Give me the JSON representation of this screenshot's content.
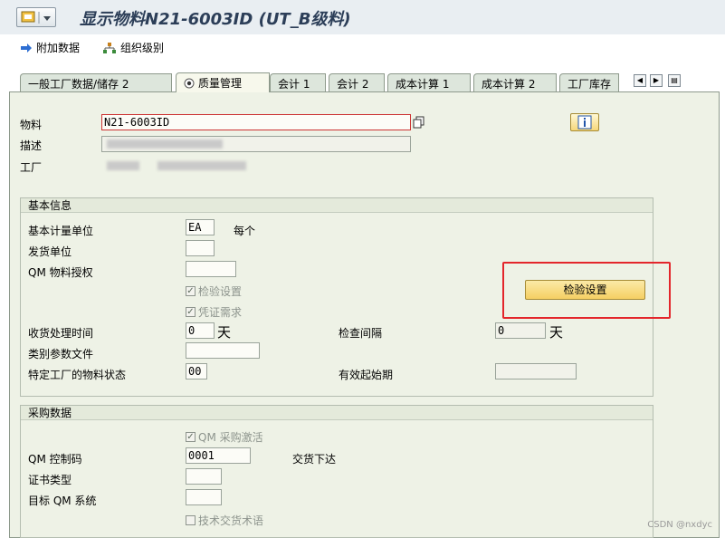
{
  "title": "显示物料N21-6003ID (UT_B级料)",
  "toolbar": {
    "additional_data": "附加数据",
    "org_levels": "组织级别"
  },
  "tabs": [
    {
      "label": "一般工厂数据/储存 2"
    },
    {
      "label": "质量管理"
    },
    {
      "label": "会计 1"
    },
    {
      "label": "会计 2"
    },
    {
      "label": "成本计算 1"
    },
    {
      "label": "成本计算 2"
    },
    {
      "label": "工厂库存"
    }
  ],
  "header": {
    "material_label": "物料",
    "material_value": "N21-6003ID",
    "description_label": "描述",
    "plant_label": "工厂"
  },
  "basic_info": {
    "title": "基本信息",
    "base_uom_label": "基本计量单位",
    "base_uom_value": "EA",
    "base_uom_text": "每个",
    "issue_unit_label": "发货单位",
    "qm_auth_label": "QM 物料授权",
    "inspection_setup_cb": "检验设置",
    "doc_required_cb": "凭证需求",
    "inspection_setup_button": "检验设置",
    "gr_processing_label": "收货处理时间",
    "gr_processing_value": "0",
    "gr_processing_unit": "天",
    "inspection_interval_label": "检查间隔",
    "inspection_interval_value": "0",
    "inspection_interval_unit": "天",
    "class_param_label": "类别参数文件",
    "plant_status_label": "特定工厂的物料状态",
    "plant_status_value": "00",
    "valid_from_label": "有效起始期"
  },
  "purchasing": {
    "title": "采购数据",
    "qm_active_cb": "QM 采购激活",
    "qm_control_label": "QM 控制码",
    "qm_control_value": "0001",
    "qm_control_text": "交货下达",
    "cert_type_label": "证书类型",
    "target_qm_label": "目标 QM 系统",
    "tech_delivery_cb": "技术交货术语"
  },
  "watermark": "CSDN @nxdyc",
  "colors": {
    "highlight": "#e3262b",
    "button_yellow": "#f5cf63",
    "panel_bg": "#eef2e6"
  }
}
